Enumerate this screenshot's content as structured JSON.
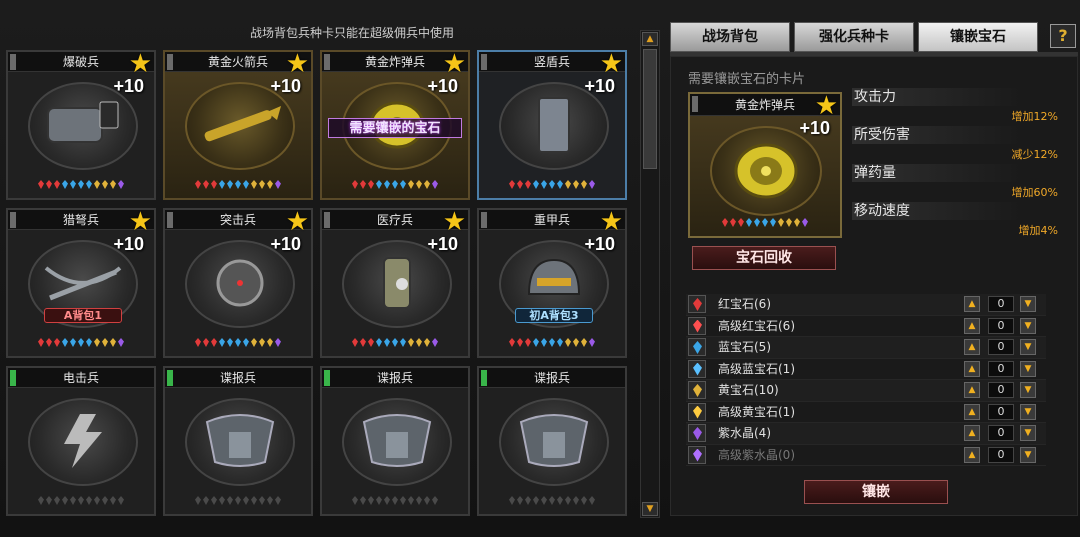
{
  "notice": "战场背包兵种卡只能在超级佣兵中使用",
  "tabs": [
    "战场背包",
    "强化兵种卡",
    "镶嵌宝石"
  ],
  "active_tab": "镶嵌宝石",
  "help_label": "?",
  "plus_label": "+10",
  "cards": [
    {
      "name": "爆破兵",
      "gold": false,
      "lock": "gray",
      "star": true,
      "plus": true,
      "overlay": "",
      "tag": "",
      "gems": "colored"
    },
    {
      "name": "黄金火箭兵",
      "gold": true,
      "lock": "gray",
      "star": true,
      "plus": true,
      "overlay": "",
      "tag": "",
      "gems": "colored"
    },
    {
      "name": "黄金炸弹兵",
      "gold": true,
      "lock": "gray",
      "star": true,
      "plus": true,
      "overlay": "需要镶嵌的宝石",
      "tag": "",
      "gems": "colored"
    },
    {
      "name": "竖盾兵",
      "gold": false,
      "lock": "gray",
      "star": true,
      "plus": true,
      "overlay": "",
      "tag": "",
      "gems": "colored",
      "selected": true
    },
    {
      "name": "猎弩兵",
      "gold": false,
      "lock": "gray",
      "star": true,
      "plus": true,
      "overlay": "",
      "tag": "A背包1",
      "tagColor": "red",
      "gems": "colored"
    },
    {
      "name": "突击兵",
      "gold": false,
      "lock": "gray",
      "star": true,
      "plus": true,
      "overlay": "",
      "tag": "",
      "gems": "colored"
    },
    {
      "name": "医疗兵",
      "gold": false,
      "lock": "gray",
      "star": true,
      "plus": true,
      "overlay": "",
      "tag": "",
      "gems": "colored"
    },
    {
      "name": "重甲兵",
      "gold": false,
      "lock": "gray",
      "star": true,
      "plus": true,
      "overlay": "",
      "tag": "初A背包3",
      "tagColor": "blue",
      "gems": "colored"
    },
    {
      "name": "电击兵",
      "gold": false,
      "lock": "green",
      "star": false,
      "plus": false,
      "overlay": "",
      "tag": "",
      "gems": "empty"
    },
    {
      "name": "谍报兵",
      "gold": false,
      "lock": "green",
      "star": false,
      "plus": false,
      "overlay": "",
      "tag": "",
      "gems": "empty"
    },
    {
      "name": "谍报兵",
      "gold": false,
      "lock": "green",
      "star": false,
      "plus": false,
      "overlay": "",
      "tag": "",
      "gems": "empty"
    },
    {
      "name": "谍报兵",
      "gold": false,
      "lock": "green",
      "star": false,
      "plus": false,
      "overlay": "",
      "tag": "",
      "gems": "empty"
    }
  ],
  "panel": {
    "need_label": "需要镶嵌宝石的卡片",
    "card_name": "黄金炸弹兵",
    "card_plus": "+10",
    "stats": [
      {
        "label": "攻击力",
        "value": "增加12%"
      },
      {
        "label": "所受伤害",
        "value": "减少12%"
      },
      {
        "label": "弹药量",
        "value": "增加60%"
      },
      {
        "label": "移动速度",
        "value": "增加4%"
      }
    ],
    "recycle_label": "宝石回收",
    "inlay_label": "镶嵌",
    "gems": [
      {
        "name": "红宝石(6)",
        "color": "#e23a3a",
        "qty": "0",
        "dim": false
      },
      {
        "name": "高级红宝石(6)",
        "color": "#ff5050",
        "qty": "0",
        "dim": false
      },
      {
        "name": "蓝宝石(5)",
        "color": "#3aa6e8",
        "qty": "0",
        "dim": false
      },
      {
        "name": "高级蓝宝石(1)",
        "color": "#5ac0ff",
        "qty": "0",
        "dim": false
      },
      {
        "name": "黄宝石(10)",
        "color": "#e0b23a",
        "qty": "0",
        "dim": false
      },
      {
        "name": "高级黄宝石(1)",
        "color": "#ffcc40",
        "qty": "0",
        "dim": false
      },
      {
        "name": "紫水晶(4)",
        "color": "#9a5ae8",
        "qty": "0",
        "dim": false
      },
      {
        "name": "高级紫水晶(0)",
        "color": "#b070ff",
        "qty": "0",
        "dim": true
      }
    ]
  }
}
